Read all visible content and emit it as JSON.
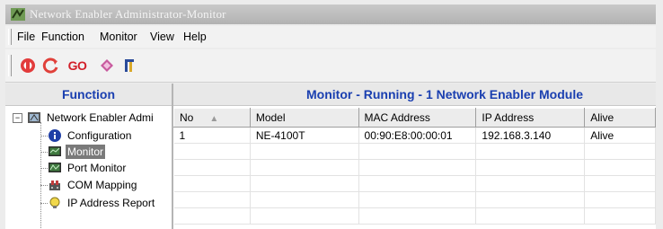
{
  "window": {
    "title": "Network Enabler Administrator-Monitor"
  },
  "menu": [
    "File",
    "Function",
    "Monitor",
    "View",
    "Help"
  ],
  "toolbar": {
    "buttons": [
      {
        "name": "connect-icon"
      },
      {
        "name": "refresh-icon"
      },
      {
        "name": "go-button",
        "text": "GO"
      },
      {
        "name": "search-icon"
      },
      {
        "name": "exit-icon"
      }
    ]
  },
  "function_panel": {
    "title": "Function",
    "tree": {
      "root": "Network Enabler Admi",
      "items": [
        {
          "label": "Configuration",
          "icon": "info-icon",
          "selected": false
        },
        {
          "label": "Monitor",
          "icon": "monitor-icon",
          "selected": true
        },
        {
          "label": "Port Monitor",
          "icon": "port-monitor-icon",
          "selected": false
        },
        {
          "label": "COM Mapping",
          "icon": "com-mapping-icon",
          "selected": false
        },
        {
          "label": "IP Address Report",
          "icon": "bulb-icon",
          "selected": false
        }
      ]
    }
  },
  "monitor_panel": {
    "title": "Monitor - Running - 1 Network Enabler Module",
    "columns": [
      "No",
      "Model",
      "MAC Address",
      "IP Address",
      "Alive"
    ],
    "rows": [
      [
        "1",
        "NE-4100T",
        "00:90:E8:00:00:01",
        "192.168.3.140",
        "Alive"
      ]
    ],
    "empty_rows": 5
  },
  "colors": {
    "panel_title": "#1a3fb0",
    "selection": "#7a7a7a"
  }
}
